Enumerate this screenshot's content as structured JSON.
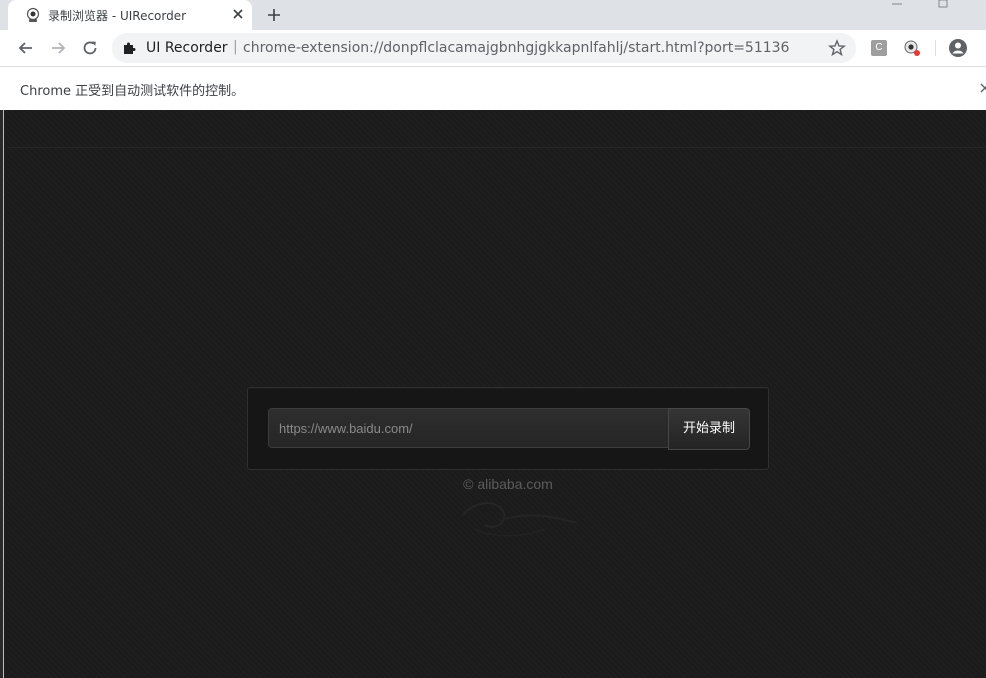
{
  "tab": {
    "title": "录制浏览器 - UIRecorder"
  },
  "omnibox": {
    "origin_label": "UI Recorder",
    "separator": "|",
    "url": "chrome-extension://donpflclacamajgbnhgjgkkapnlfahlj/start.html?port=51136"
  },
  "infobar": {
    "message": "Chrome 正受到自动测试软件的控制。"
  },
  "page": {
    "url_input_value": "https://www.baidu.com/",
    "start_button_label": "开始录制",
    "copyright": "© alibaba.com"
  },
  "extensions": {
    "c_label": "C"
  },
  "icons": {
    "favicon": "recorder-icon",
    "back": "arrow-left-icon",
    "forward": "arrow-right-icon",
    "reload": "reload-icon",
    "extension": "puzzle-icon",
    "bookmark": "star-icon",
    "profile": "account-icon"
  },
  "colors": {
    "page_bg": "#1b1b1b",
    "button_text": "#ffffff",
    "input_text": "#8a8a8a"
  }
}
